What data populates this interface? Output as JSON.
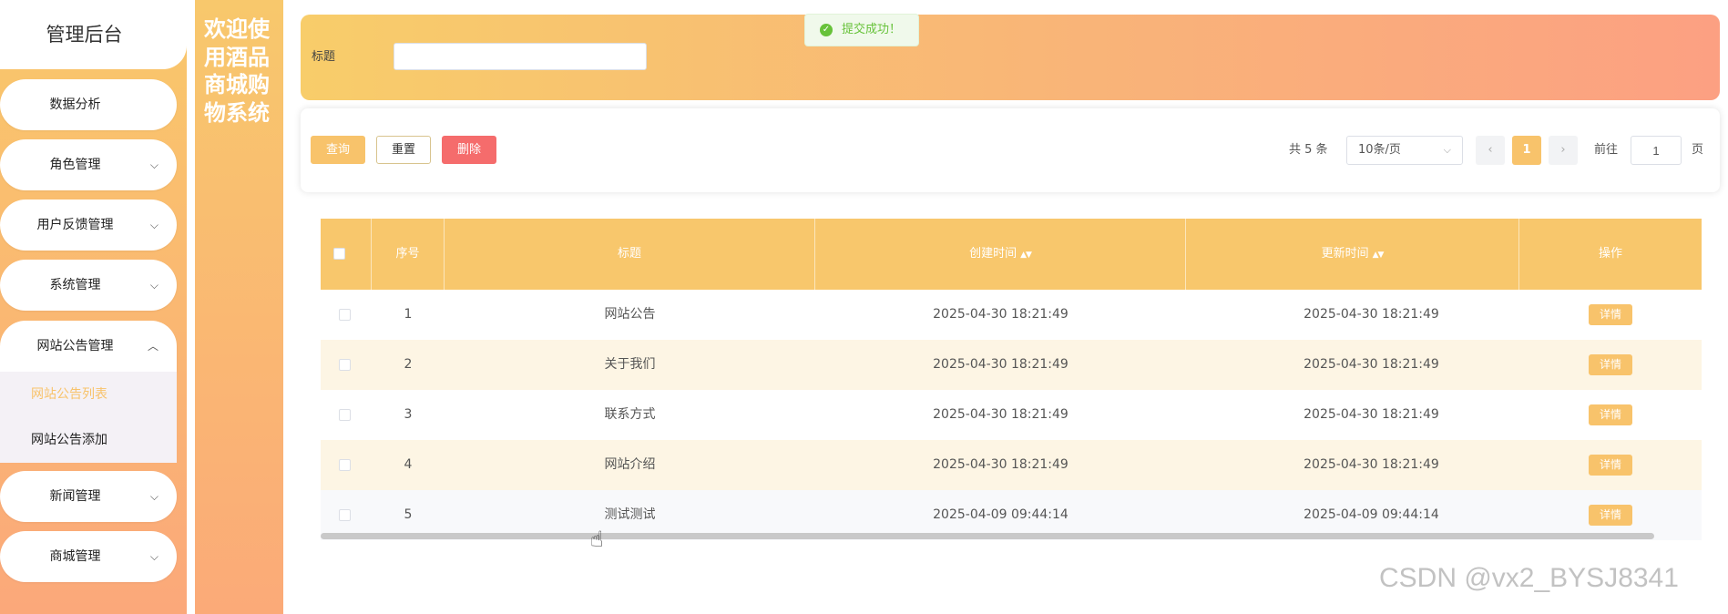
{
  "sidebar": {
    "title": "管理后台",
    "items": [
      {
        "label": "数据分析",
        "arrow": ""
      },
      {
        "label": "角色管理",
        "arrow": "⌵"
      },
      {
        "label": "用户反馈管理",
        "arrow": "⌵"
      },
      {
        "label": "系统管理",
        "arrow": "⌵"
      },
      {
        "label": "网站公告管理",
        "arrow": "︿"
      },
      {
        "label": "新闻管理",
        "arrow": "⌵"
      },
      {
        "label": "商城管理",
        "arrow": "⌵"
      }
    ],
    "submenu": [
      "网站公告列表",
      "网站公告添加"
    ]
  },
  "welcome": "欢迎使用酒品商城购物系统",
  "search": {
    "label": "标题",
    "value": "",
    "placeholder": ""
  },
  "toast": {
    "text": "提交成功！",
    "icon": "check-circle-icon"
  },
  "toolbar": {
    "search_label": "查询",
    "reset_label": "重置",
    "delete_label": "删除"
  },
  "pagination": {
    "total": "共 5 条",
    "page_size": "10条/页",
    "prev": "‹",
    "current": "1",
    "next": "›",
    "goto": "前往",
    "jump_value": "1",
    "page_suffix": "页"
  },
  "table": {
    "headers": [
      "序号",
      "标题",
      "创建时间",
      "更新时间",
      "操作"
    ],
    "rows": [
      {
        "index": "1",
        "title": "网站公告",
        "created": "2025-04-30 18:21:49",
        "updated": "2025-04-30 18:21:49",
        "action": "详情"
      },
      {
        "index": "2",
        "title": "关于我们",
        "created": "2025-04-30 18:21:49",
        "updated": "2025-04-30 18:21:49",
        "action": "详情"
      },
      {
        "index": "3",
        "title": "联系方式",
        "created": "2025-04-30 18:21:49",
        "updated": "2025-04-30 18:21:49",
        "action": "详情"
      },
      {
        "index": "4",
        "title": "网站介绍",
        "created": "2025-04-30 18:21:49",
        "updated": "2025-04-30 18:21:49",
        "action": "详情"
      },
      {
        "index": "5",
        "title": "测试测试",
        "created": "2025-04-09 09:44:14",
        "updated": "2025-04-09 09:44:14",
        "action": "详情"
      }
    ]
  },
  "watermark": "CSDN @vx2_BYSJ8341",
  "colors": {
    "accent": "#f8c36b",
    "danger": "#f56c6c",
    "success": "#67c23a"
  }
}
